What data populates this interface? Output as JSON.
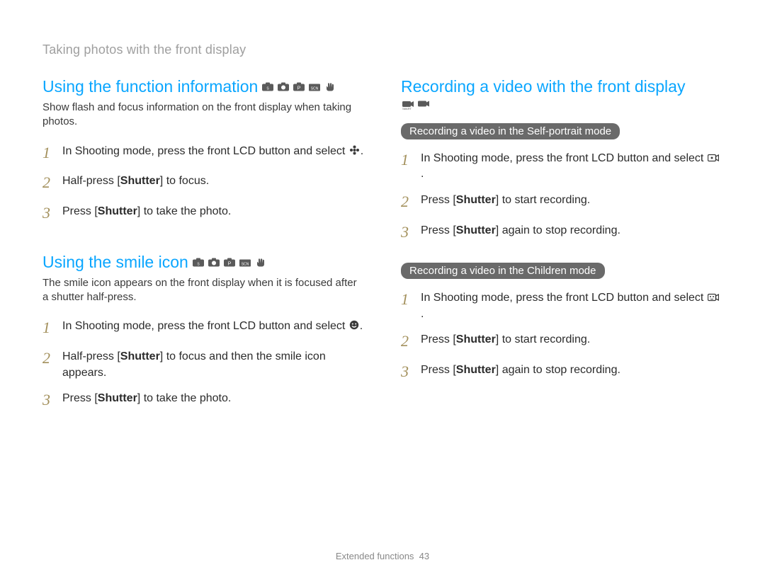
{
  "breadcrumb": "Taking photos with the front display",
  "left": {
    "sec1": {
      "title": "Using the function information",
      "subtext": "Show flash and focus information on the front display when taking photos.",
      "step1a": "In Shooting mode, press the front LCD button and select ",
      "step1b": ".",
      "step2a": "Half-press [",
      "step2b": "] to focus.",
      "step3a": "Press [",
      "step3b": "] to take the photo."
    },
    "sec2": {
      "title": "Using the smile icon",
      "subtext": "The smile icon appears on the front display when it is focused after a shutter half-press.",
      "step1a": "In Shooting mode, press the front LCD button and select ",
      "step1b": ".",
      "step2a": "Half-press [",
      "step2b": "] to focus and then the smile icon appears.",
      "step3a": "Press [",
      "step3b": "] to take the photo."
    }
  },
  "right": {
    "sec1": {
      "title": "Recording a video with the front display"
    },
    "sub1": {
      "pill": "Recording a video in the Self-portrait mode",
      "step1a": "In Shooting mode, press the front LCD button and select ",
      "step1b": ".",
      "step2a": "Press [",
      "step2b": "] to start recording.",
      "step3a": "Press [",
      "step3b": "] again to stop recording."
    },
    "sub2": {
      "pill": "Recording a video in the Children mode",
      "step1a": "In Shooting mode, press the front LCD button and select ",
      "step1b": ".",
      "step2a": "Press [",
      "step2b": "] to start recording.",
      "step3a": "Press [",
      "step3b": "] again to stop recording."
    }
  },
  "boldShutter": "Shutter",
  "footer_section": "Extended functions",
  "footer_page": "43",
  "icons": {
    "mode_row5": [
      "smart-icon",
      "camera-icon",
      "camera-p-icon",
      "scene-icon",
      "hand-icon"
    ],
    "mode_row2": [
      "video-smart-icon",
      "video-icon"
    ]
  }
}
